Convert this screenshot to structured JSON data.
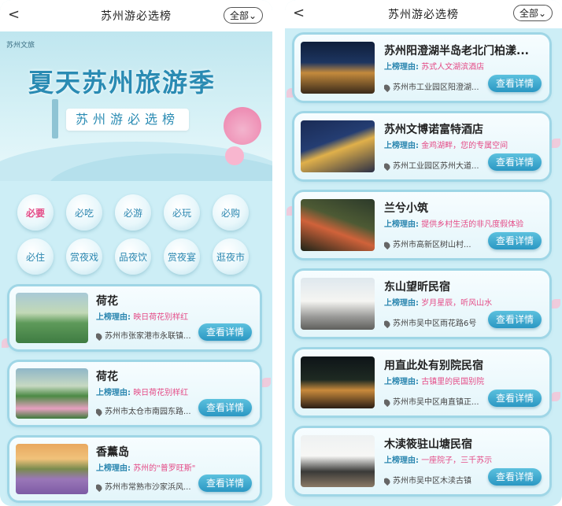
{
  "left": {
    "header": {
      "back": "<",
      "title": "苏州游必选榜",
      "filter": "全部⌄"
    },
    "banner": {
      "logo": "苏州文旅",
      "title": "夏天苏州旅游季",
      "subtitle": "苏州游必选榜"
    },
    "categories": [
      {
        "label": "必要",
        "active": true
      },
      {
        "label": "必吃",
        "active": false
      },
      {
        "label": "必游",
        "active": false
      },
      {
        "label": "必玩",
        "active": false
      },
      {
        "label": "必购",
        "active": false
      },
      {
        "label": "必住",
        "active": false
      },
      {
        "label": "赏夜戏",
        "active": false
      },
      {
        "label": "品夜饮",
        "active": false
      },
      {
        "label": "赏夜宴",
        "active": false
      },
      {
        "label": "逛夜市",
        "active": false
      }
    ],
    "cards": [
      {
        "title": "荷花",
        "reason_label": "上榜理由:",
        "reason": "映日荷花别样红",
        "address": "苏州市张家港市永联镇...",
        "button": "查看详情"
      },
      {
        "title": "荷花",
        "reason_label": "上榜理由:",
        "reason": "映日荷花别样红",
        "address": "苏州市太仓市南园东路...",
        "button": "查看详情"
      },
      {
        "title": "香薰岛",
        "reason_label": "上榜理由:",
        "reason": "苏州的\"普罗旺斯\"",
        "address": "苏州市常熟市沙家浜风...",
        "button": "查看详情"
      }
    ]
  },
  "right": {
    "header": {
      "back": "<",
      "title": "苏州游必选榜",
      "filter": "全部⌄"
    },
    "cards": [
      {
        "title": "苏州阳澄湖半岛老北门柏漾...",
        "reason_label": "上榜理由:",
        "reason": "苏式人文湖滨酒店",
        "address": "苏州市工业园区阳澄湖...",
        "button": "查看详情"
      },
      {
        "title": "苏州文博诺富特酒店",
        "reason_label": "上榜理由:",
        "reason": "金鸡湖畔，您的专属空间",
        "address": "苏州工业园区苏州大道...",
        "button": "查看详情"
      },
      {
        "title": "兰兮小筑",
        "reason_label": "上榜理由:",
        "reason": "提供乡村生活的非凡度假体验",
        "address": "苏州市高新区树山村...",
        "button": "查看详情"
      },
      {
        "title": "东山望昕民宿",
        "reason_label": "上榜理由:",
        "reason": "岁月星辰，听风山水",
        "address": "苏州市吴中区雨花路6号",
        "button": "查看详情"
      },
      {
        "title": "用直此处有别院民宿",
        "reason_label": "上榜理由:",
        "reason": "古镇里的民国别院",
        "address": "苏州市吴中区甪直镇正...",
        "button": "查看详情"
      },
      {
        "title": "木渎筱驻山塘民宿",
        "reason_label": "上榜理由:",
        "reason": "一座院子，三千苏示",
        "address": "苏州市吴中区木渎古镇",
        "button": "查看详情"
      }
    ]
  },
  "colors": {
    "accent": "#2b97c3",
    "reason_value": "#e44a86",
    "background": "#cdeef6"
  }
}
